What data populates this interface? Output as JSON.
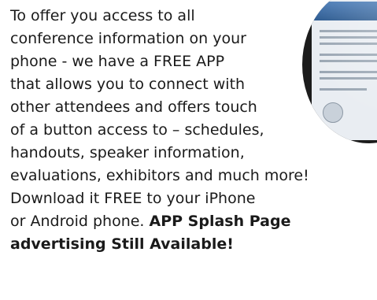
{
  "content": {
    "lines": [
      "To offer you access to all",
      "conference information on your",
      "phone - we have a FREE APP",
      "that allows you to connect with",
      "other attendees and offers touch",
      "of a button access to – schedules,",
      "handouts, speaker information,",
      "evaluations, exhibitors and much more!",
      "Download it FREE to your iPhone"
    ],
    "last_line_normal": "or Android phone. ",
    "last_line_bold": "APP Splash Page",
    "final_line_bold": "advertising Still Available!"
  }
}
